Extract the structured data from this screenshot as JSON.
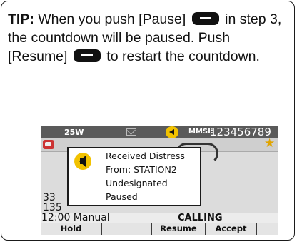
{
  "tip": {
    "label": "TIP:",
    "text_1": " When you push [Pause]",
    "text_2": " in step 3, the countdown will be paused. Push [Resume]",
    "text_3": " to restart the countdown."
  },
  "screen": {
    "status_bar": {
      "power": "25W",
      "mmsi_label": "MMSI:",
      "mmsi_value": "123456789"
    },
    "background": {
      "left_value_1": "33",
      "left_value_2": "135",
      "time": "12:00 Manual",
      "state": "CALLING"
    },
    "popup": {
      "line_1": "Received Distress",
      "line_2": "From: STATION2",
      "line_3": "Undesignated",
      "line_4": "Paused"
    },
    "softkeys": [
      "Hold",
      "",
      "Resume",
      "Accept",
      ""
    ]
  }
}
